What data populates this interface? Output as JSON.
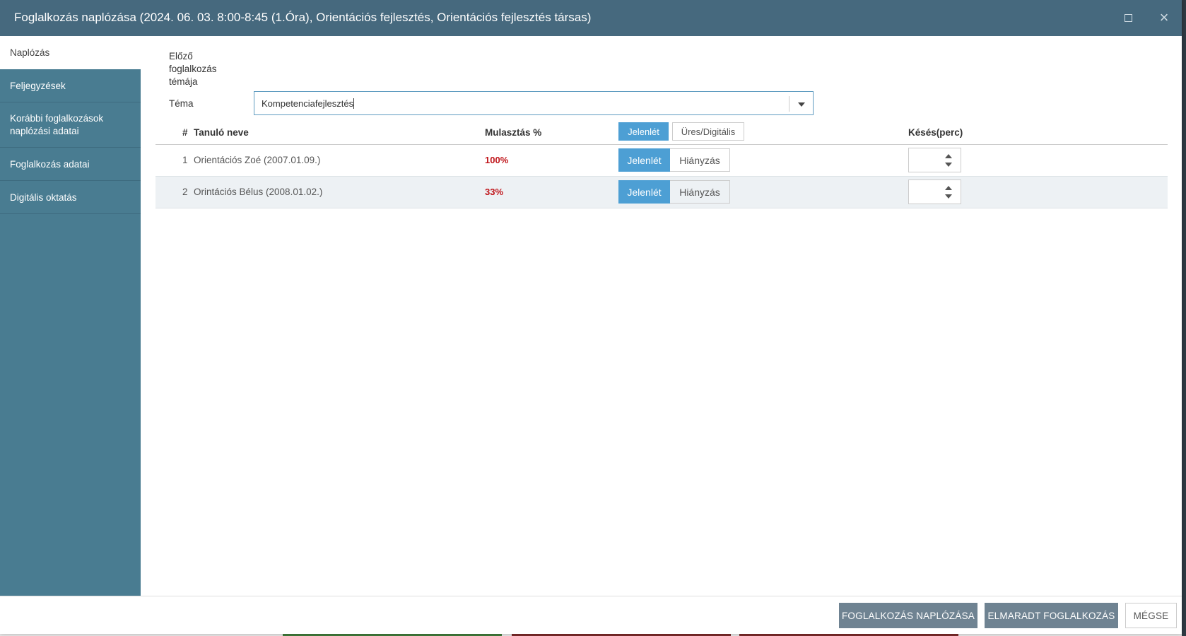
{
  "window": {
    "title": "Foglalkozás naplózása (2024. 06. 03. 8:00-8:45 (1.Óra), Orientációs fejlesztés, Orientációs fejlesztés társas)",
    "maximize_icon": "maximize-icon",
    "close_icon": "close-icon",
    "close_glyph": "×"
  },
  "sidebar": {
    "items": [
      {
        "label": "Naplózás",
        "active": true
      },
      {
        "label": "Feljegyzések",
        "active": false
      },
      {
        "label": "Korábbi foglalkozások naplózási adatai",
        "active": false
      },
      {
        "label": "Foglalkozás adatai",
        "active": false
      },
      {
        "label": "Digitális oktatás",
        "active": false
      }
    ]
  },
  "form": {
    "previous_topic_label": "Előző foglalkozás témája",
    "topic_label": "Téma",
    "topic_value": "Kompetenciafejlesztés"
  },
  "table": {
    "headers": {
      "num": "#",
      "name": "Tanuló neve",
      "absence": "Mulasztás %",
      "bulk_present": "Jelenlét",
      "bulk_empty": "Üres/Digitális",
      "late": "Késés(perc)"
    },
    "rows": [
      {
        "num": "1",
        "name": "Orientációs Zoé (2007.01.09.)",
        "absence": "100%",
        "present": "Jelenlét",
        "absent": "Hiányzás",
        "late": ""
      },
      {
        "num": "2",
        "name": "Orintációs Bélus (2008.01.02.)",
        "absence": "33%",
        "present": "Jelenlét",
        "absent": "Hiányzás",
        "late": ""
      }
    ]
  },
  "footer": {
    "log_button": "FOGLALKOZÁS NAPLÓZÁSA",
    "missed_button": "ELMARADT FOGLALKOZÁS",
    "cancel_button": "MÉGSE"
  },
  "colors": {
    "titlebar": "#46697e",
    "sidebar": "#497c91",
    "accent": "#4d9fd4",
    "danger": "#c0161b",
    "footer_button": "#6f8392"
  }
}
